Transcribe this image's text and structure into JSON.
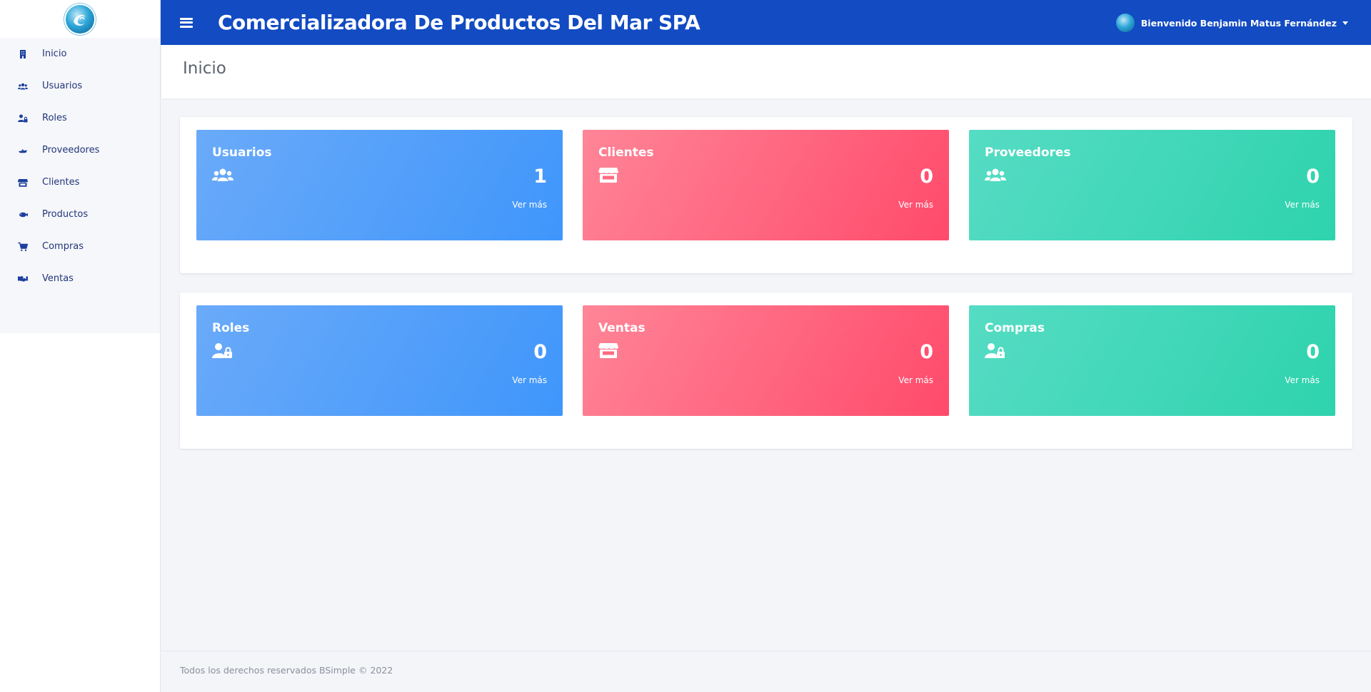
{
  "app": {
    "title": "Comercializadora De Productos Del Mar SPA"
  },
  "user": {
    "greeting": "Bienvenido Benjamin Matus Fernández"
  },
  "sidebar": {
    "items": [
      {
        "label": "Inicio",
        "icon": "building-icon"
      },
      {
        "label": "Usuarios",
        "icon": "users-icon"
      },
      {
        "label": "Roles",
        "icon": "user-lock-icon"
      },
      {
        "label": "Proveedores",
        "icon": "truck-icon"
      },
      {
        "label": "Clientes",
        "icon": "store-icon"
      },
      {
        "label": "Productos",
        "icon": "fish-icon"
      },
      {
        "label": "Compras",
        "icon": "cart-icon"
      },
      {
        "label": "Ventas",
        "icon": "handshake-icon"
      }
    ]
  },
  "page": {
    "title": "Inicio"
  },
  "cards_row1": [
    {
      "title": "Usuarios",
      "value": "1",
      "link": "Ver más",
      "icon": "users-icon",
      "color": "blue"
    },
    {
      "title": "Clientes",
      "value": "0",
      "link": "Ver más",
      "icon": "store-icon",
      "color": "red"
    },
    {
      "title": "Proveedores",
      "value": "0",
      "link": "Ver más",
      "icon": "users-icon",
      "color": "green"
    }
  ],
  "cards_row2": [
    {
      "title": "Roles",
      "value": "0",
      "link": "Ver más",
      "icon": "user-lock-icon",
      "color": "blue"
    },
    {
      "title": "Ventas",
      "value": "0",
      "link": "Ver más",
      "icon": "store-icon",
      "color": "red"
    },
    {
      "title": "Compras",
      "value": "0",
      "link": "Ver más",
      "icon": "user-lock-icon",
      "color": "green"
    }
  ],
  "colors": {
    "topbar": "#124bc2",
    "blue": "#3f96fb",
    "red": "#ff4a6b",
    "green": "#2ed3ad"
  },
  "footer": {
    "text": "Todos los derechos reservados BSimple © 2022"
  }
}
